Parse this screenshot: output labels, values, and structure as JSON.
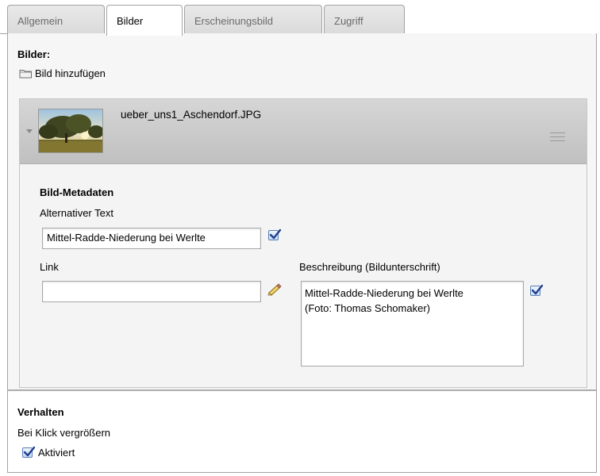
{
  "tabs": [
    {
      "label": "Allgemein",
      "active": false
    },
    {
      "label": "Bilder",
      "active": true
    },
    {
      "label": "Erscheinungsbild",
      "active": false
    },
    {
      "label": "Zugriff",
      "active": false
    }
  ],
  "images_section": {
    "title": "Bilder:",
    "add_label": "Bild hinzufügen",
    "add_icon": "folder-icon"
  },
  "image_item": {
    "filename": "ueber_uns1_Aschendorf.JPG",
    "toggle_icon": "caret-down-icon",
    "drag_icon": "drag-handle-icon",
    "metadata": {
      "title": "Bild-Metadaten",
      "alt_label": "Alternativer Text",
      "alt_value": "Mittel-Radde-Niederung bei Werlte",
      "alt_override_checked": true,
      "link_label": "Link",
      "link_value": "",
      "link_icon": "pencil-icon",
      "description_label": "Beschreibung (Bildunterschrift)",
      "description_value": "Mittel-Radde-Niederung bei Werlte\n(Foto: Thomas Schomaker)",
      "description_override_checked": true
    }
  },
  "behavior": {
    "title": "Verhalten",
    "zoom_label": "Bei Klick vergrößern",
    "zoom_checkbox_label": "Aktiviert",
    "zoom_checked": true
  },
  "colors": {
    "panel_bg": "#f6f6f6",
    "header_gradient_top": "#d6d6d6",
    "header_gradient_bottom": "#c0c0c0",
    "border": "#a3a3a3",
    "checkbox_accent": "#1d3f8f"
  }
}
